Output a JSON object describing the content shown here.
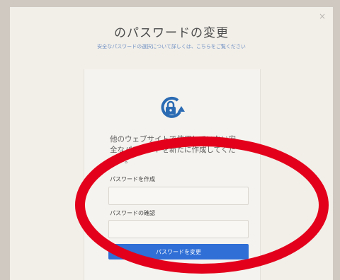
{
  "dialog": {
    "close_label": "×",
    "title": "のパスワードの変更",
    "subtitle": "安全なパスワードの選択について詳しくは、こちらをご覧ください"
  },
  "card": {
    "description": "他のウェブサイトで使用していない安全なパスワードを新たに作成してください。",
    "new_password_label": "パスワードを作成",
    "confirm_password_label": "パスワードの確認",
    "new_password_value": "",
    "confirm_password_value": "",
    "submit_label": "パスワードを変更"
  },
  "icons": {
    "lock": "lock-refresh-icon",
    "close": "close-icon"
  },
  "colors": {
    "accent": "#2f6fd6",
    "link": "#6e8fc2",
    "annotation": "#e3001b"
  }
}
